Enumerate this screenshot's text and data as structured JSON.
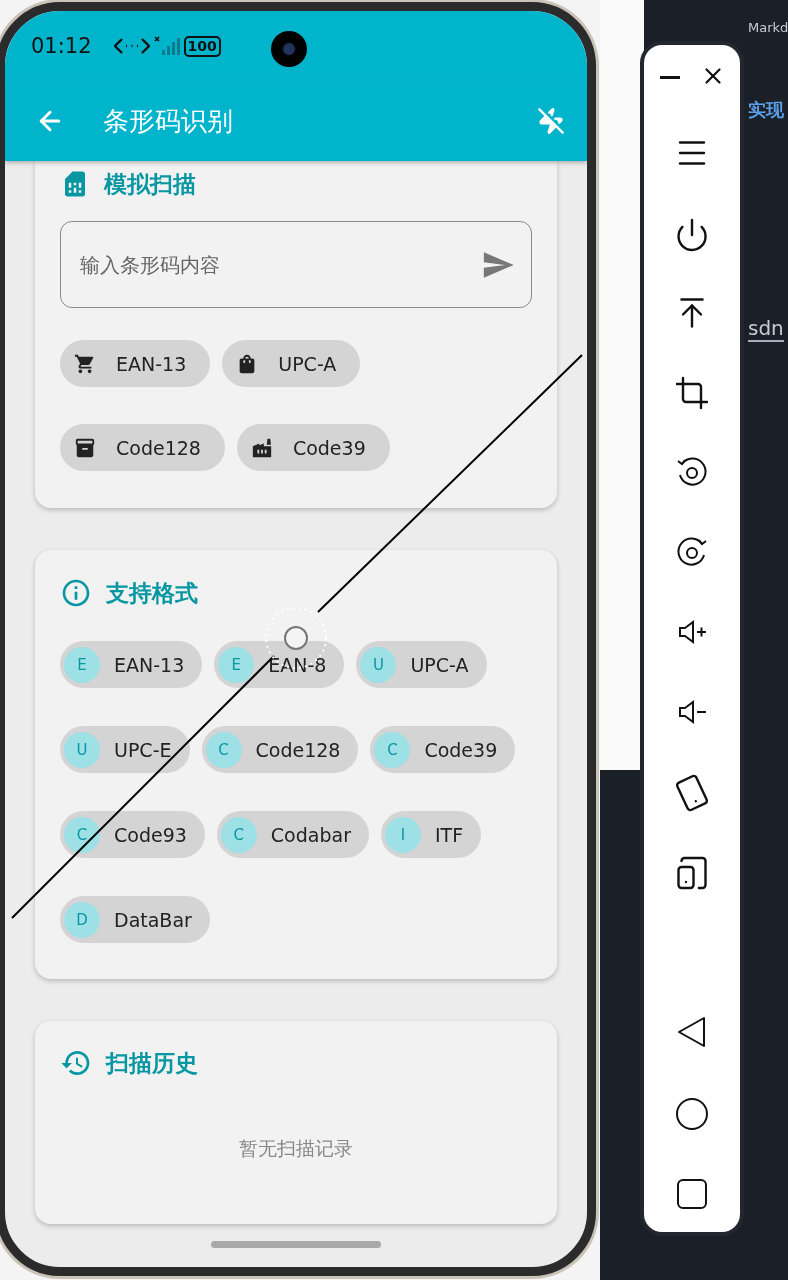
{
  "status_bar": {
    "time": "01:12",
    "battery": "100"
  },
  "app_bar": {
    "title": "条形码识别"
  },
  "simulate": {
    "title": "模拟扫描",
    "input": {
      "placeholder": "输入条形码内容"
    },
    "chips": [
      {
        "label": "EAN-13"
      },
      {
        "label": "UPC-A"
      },
      {
        "label": "Code128"
      },
      {
        "label": "Code39"
      }
    ]
  },
  "formats": {
    "title": "支持格式",
    "items": [
      {
        "initial": "E",
        "label": "EAN-13"
      },
      {
        "initial": "E",
        "label": "EAN-8"
      },
      {
        "initial": "U",
        "label": "UPC-A"
      },
      {
        "initial": "U",
        "label": "UPC-E"
      },
      {
        "initial": "C",
        "label": "Code128"
      },
      {
        "initial": "C",
        "label": "Code39"
      },
      {
        "initial": "C",
        "label": "Code93"
      },
      {
        "initial": "C",
        "label": "Codabar"
      },
      {
        "initial": "I",
        "label": "ITF"
      },
      {
        "initial": "D",
        "label": "DataBar"
      }
    ]
  },
  "history": {
    "title": "扫描历史",
    "empty": "暂无扫描记录"
  },
  "editor": {
    "tab": "Markd",
    "heading": "实现",
    "link": "sdn"
  }
}
